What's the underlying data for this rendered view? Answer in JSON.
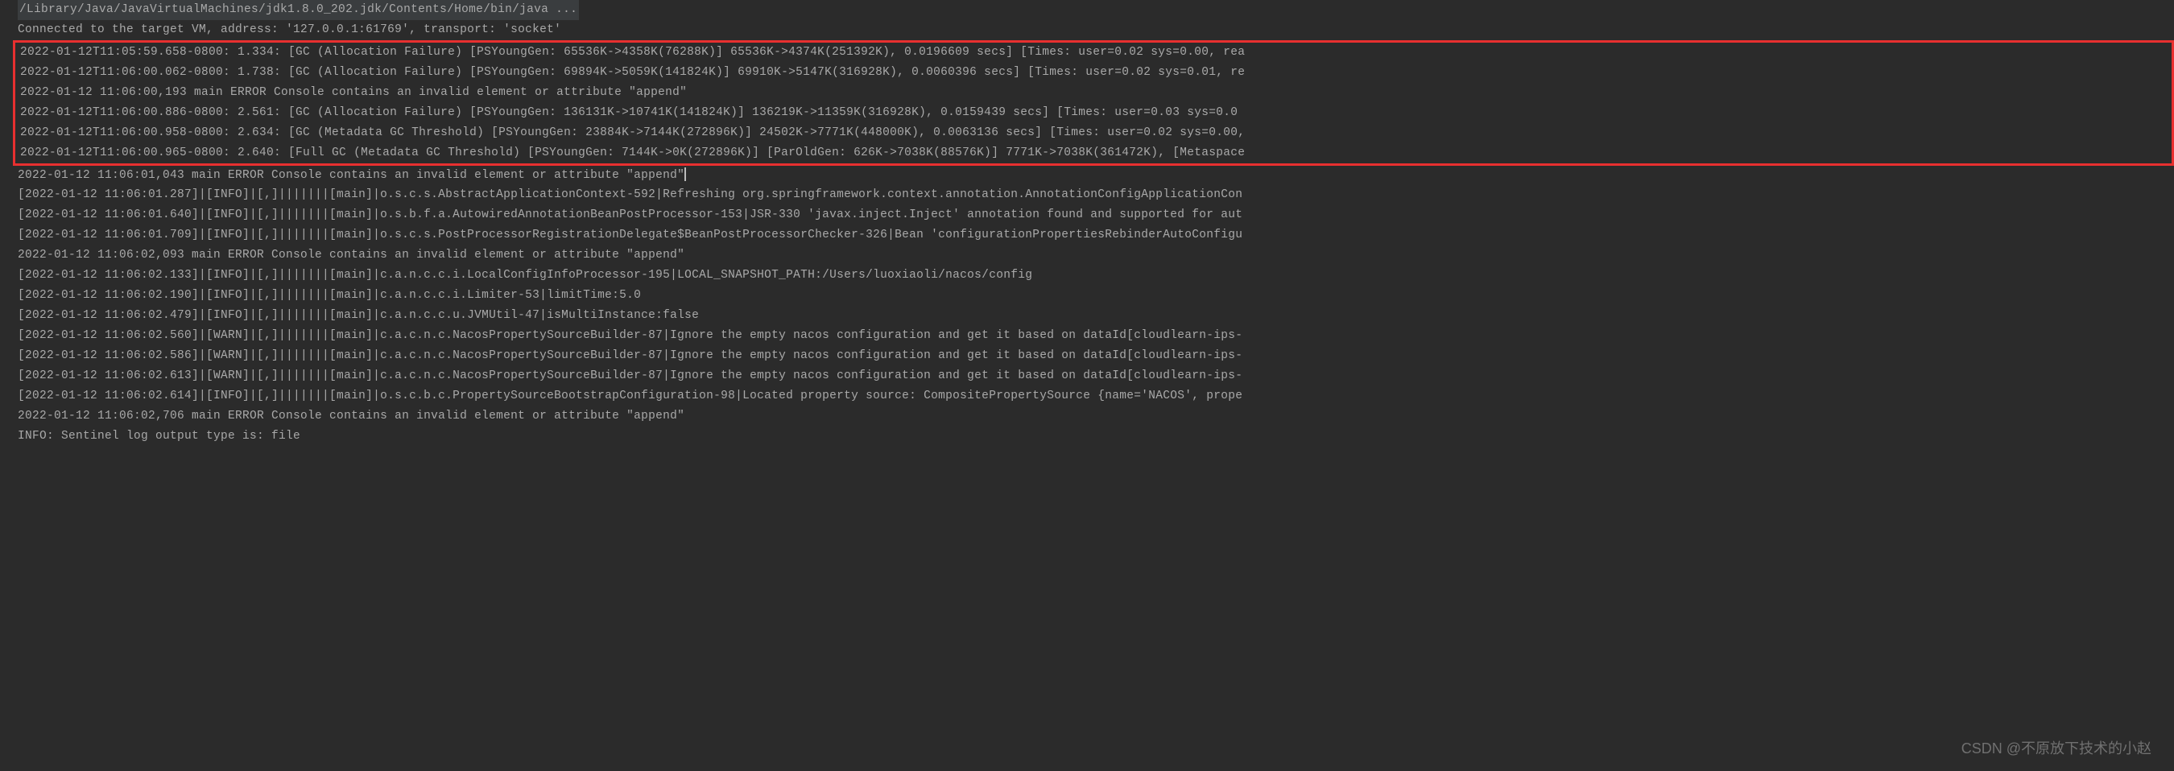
{
  "header": {
    "java_path": "/Library/Java/JavaVirtualMachines/jdk1.8.0_202.jdk/Contents/Home/bin/java ...",
    "connect_line": "Connected to the target VM, address: '127.0.0.1:61769', transport: 'socket'"
  },
  "gc_box": {
    "lines": [
      "2022-01-12T11:05:59.658-0800: 1.334: [GC (Allocation Failure) [PSYoungGen: 65536K->4358K(76288K)] 65536K->4374K(251392K), 0.0196609 secs] [Times: user=0.02 sys=0.00, rea",
      "2022-01-12T11:06:00.062-0800: 1.738: [GC (Allocation Failure) [PSYoungGen: 69894K->5059K(141824K)] 69910K->5147K(316928K), 0.0060396 secs] [Times: user=0.02 sys=0.01, re",
      "2022-01-12 11:06:00,193 main ERROR Console contains an invalid element or attribute \"append\"",
      "2022-01-12T11:06:00.886-0800: 2.561: [GC (Allocation Failure) [PSYoungGen: 136131K->10741K(141824K)] 136219K->11359K(316928K), 0.0159439 secs] [Times: user=0.03 sys=0.0",
      "2022-01-12T11:06:00.958-0800: 2.634: [GC (Metadata GC Threshold) [PSYoungGen: 23884K->7144K(272896K)] 24502K->7771K(448000K), 0.0063136 secs] [Times: user=0.02 sys=0.00,",
      "2022-01-12T11:06:00.965-0800: 2.640: [Full GC (Metadata GC Threshold) [PSYoungGen: 7144K->0K(272896K)] [ParOldGen: 626K->7038K(88576K)] 7771K->7038K(361472K), [Metaspace"
    ]
  },
  "log": {
    "lines": [
      "2022-01-12 11:06:01,043 main ERROR Console contains an invalid element or attribute \"append\"",
      "[2022-01-12 11:06:01.287]|[INFO]|[,]|||||||[main]|o.s.c.s.AbstractApplicationContext-592|Refreshing org.springframework.context.annotation.AnnotationConfigApplicationCon",
      "[2022-01-12 11:06:01.640]|[INFO]|[,]|||||||[main]|o.s.b.f.a.AutowiredAnnotationBeanPostProcessor-153|JSR-330 'javax.inject.Inject' annotation found and supported for aut",
      "[2022-01-12 11:06:01.709]|[INFO]|[,]|||||||[main]|o.s.c.s.PostProcessorRegistrationDelegate$BeanPostProcessorChecker-326|Bean 'configurationPropertiesRebinderAutoConfigu",
      "2022-01-12 11:06:02,093 main ERROR Console contains an invalid element or attribute \"append\"",
      "[2022-01-12 11:06:02.133]|[INFO]|[,]|||||||[main]|c.a.n.c.c.i.LocalConfigInfoProcessor-195|LOCAL_SNAPSHOT_PATH:/Users/luoxiaoli/nacos/config",
      "[2022-01-12 11:06:02.190]|[INFO]|[,]|||||||[main]|c.a.n.c.c.i.Limiter-53|limitTime:5.0",
      "[2022-01-12 11:06:02.479]|[INFO]|[,]|||||||[main]|c.a.n.c.c.u.JVMUtil-47|isMultiInstance:false",
      "[2022-01-12 11:06:02.560]|[WARN]|[,]|||||||[main]|c.a.c.n.c.NacosPropertySourceBuilder-87|Ignore the empty nacos configuration and get it based on dataId[cloudlearn-ips-",
      "[2022-01-12 11:06:02.586]|[WARN]|[,]|||||||[main]|c.a.c.n.c.NacosPropertySourceBuilder-87|Ignore the empty nacos configuration and get it based on dataId[cloudlearn-ips-",
      "[2022-01-12 11:06:02.613]|[WARN]|[,]|||||||[main]|c.a.c.n.c.NacosPropertySourceBuilder-87|Ignore the empty nacos configuration and get it based on dataId[cloudlearn-ips-",
      "[2022-01-12 11:06:02.614]|[INFO]|[,]|||||||[main]|o.s.c.b.c.PropertySourceBootstrapConfiguration-98|Located property source: CompositePropertySource {name='NACOS', prope",
      "2022-01-12 11:06:02,706 main ERROR Console contains an invalid element or attribute \"append\"",
      "INFO: Sentinel log output type is: file"
    ]
  },
  "watermark": "CSDN @不原放下技术的小赵"
}
